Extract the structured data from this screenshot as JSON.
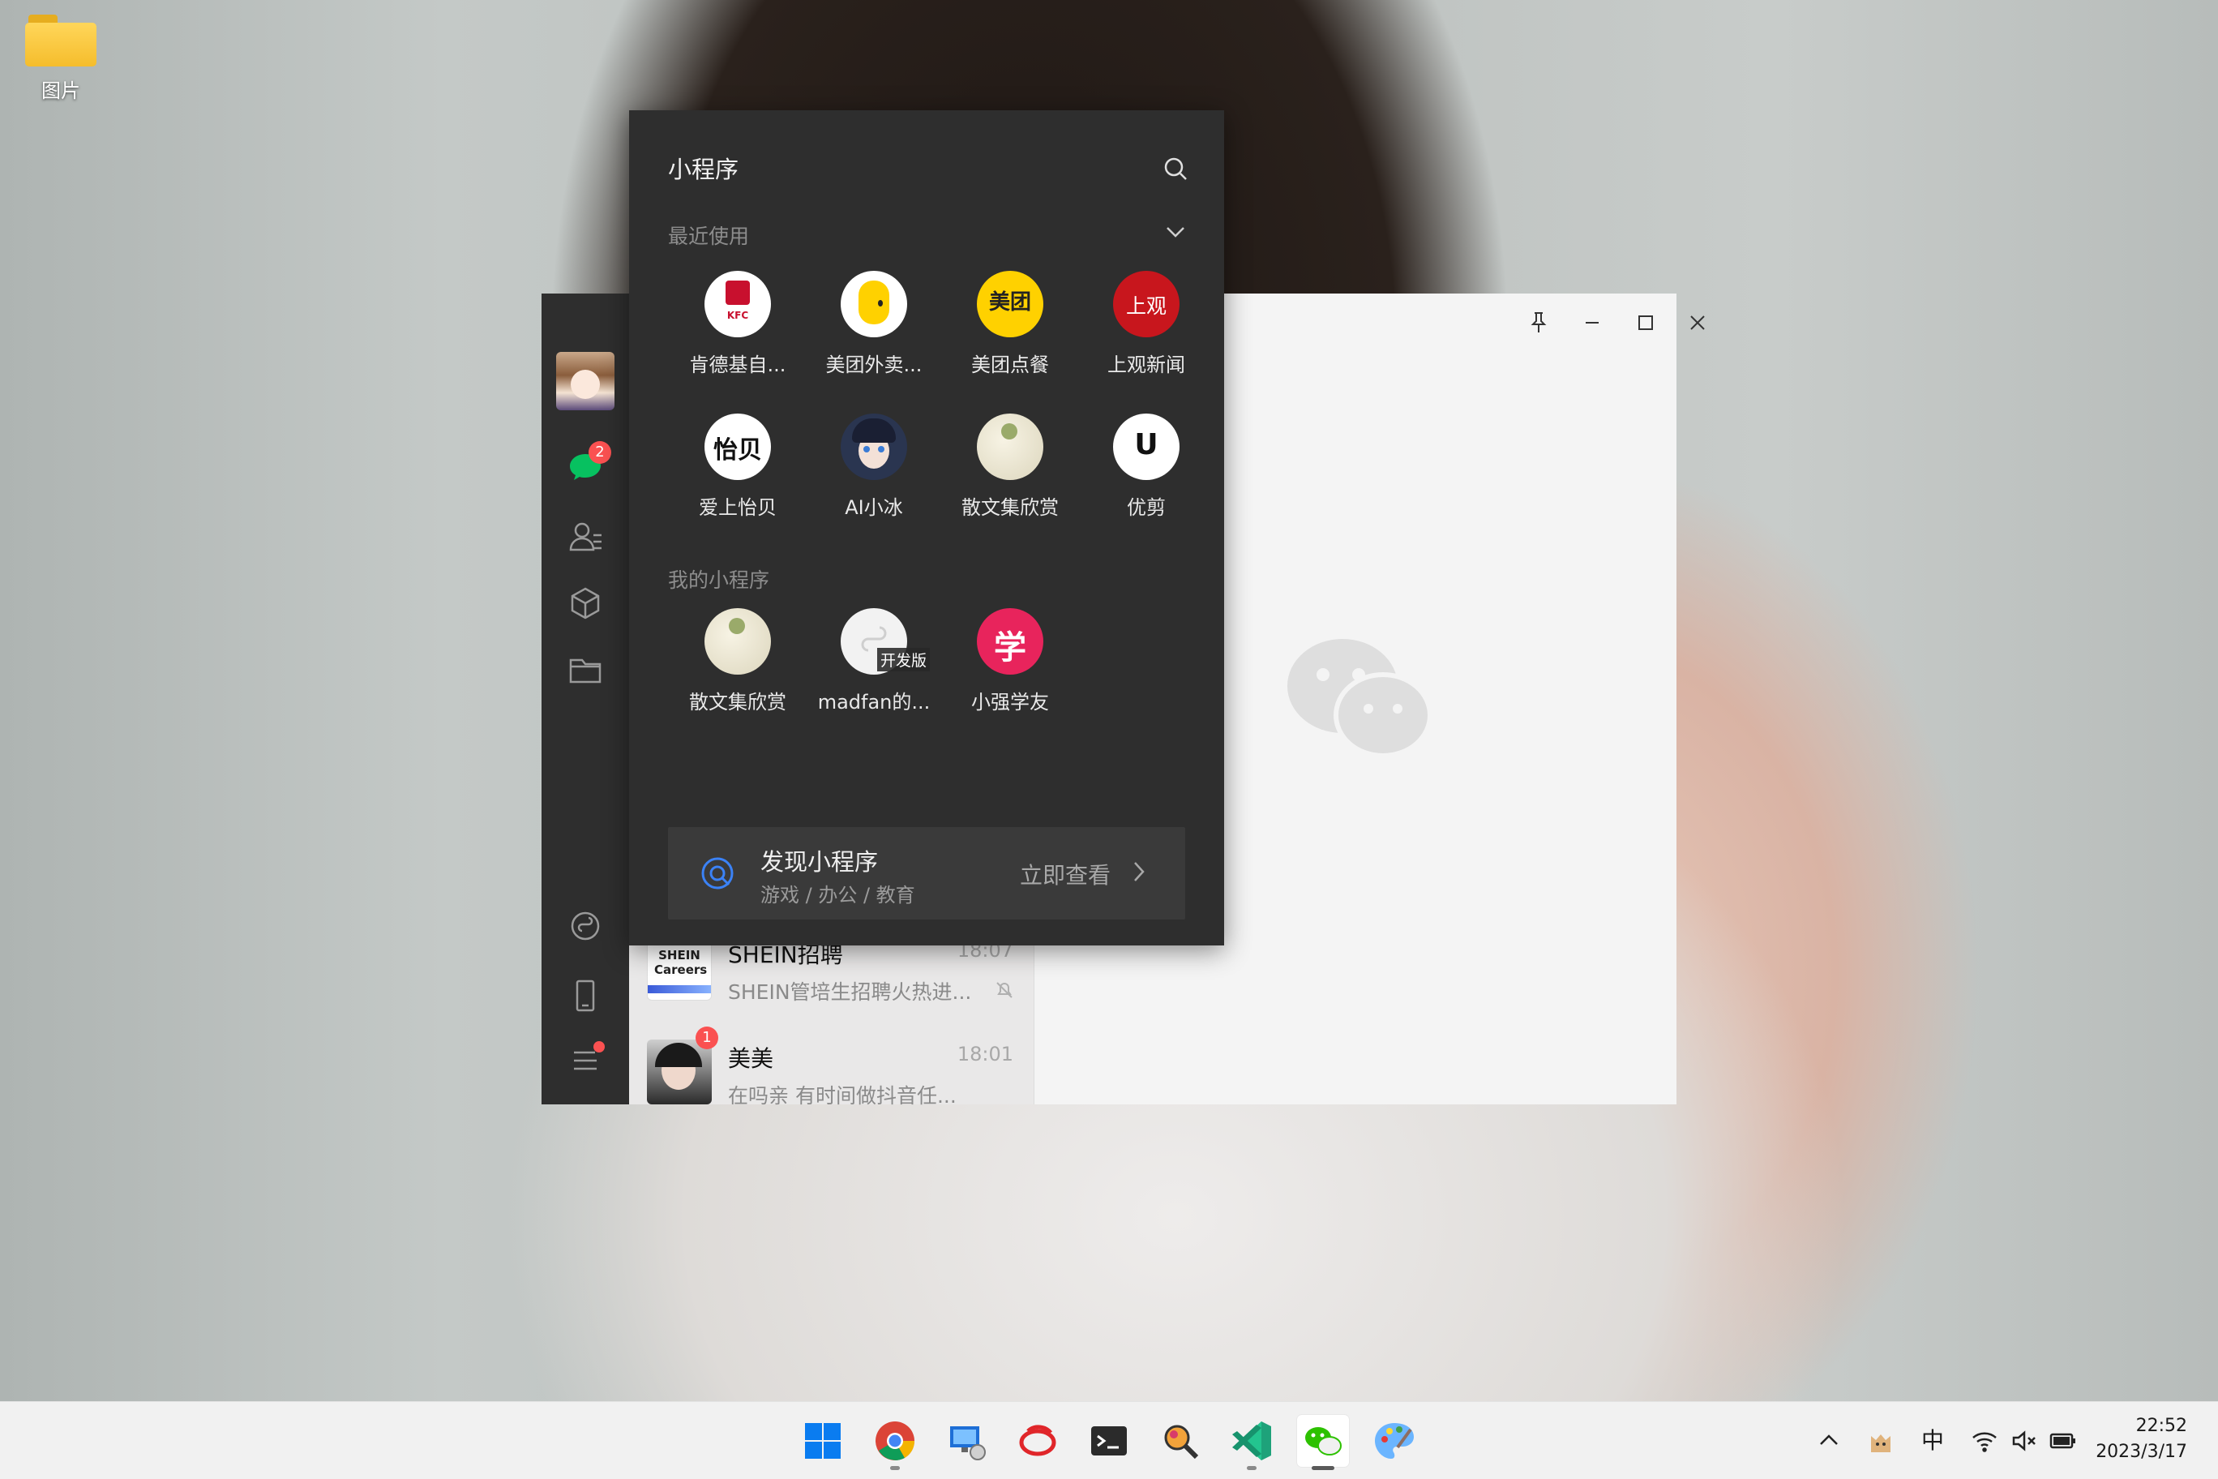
{
  "desktop": {
    "icons": [
      {
        "label": "图片"
      }
    ]
  },
  "wechat": {
    "sidebar": {
      "chats_badge": "2"
    },
    "chat_list": [
      {
        "name": "SHEIN招聘",
        "time": "18:07",
        "preview": "SHEIN管培生招聘火热进...",
        "avatar_text": "SHEIN Careers"
      },
      {
        "name": "美美",
        "time": "18:01",
        "preview": "在吗亲  有时间做抖音任...",
        "unread": "1"
      }
    ]
  },
  "mini_programs": {
    "title": "小程序",
    "recent_label": "最近使用",
    "recent": [
      {
        "name": "肯德基自...",
        "icon_text": "KFC"
      },
      {
        "name": "美团外卖...",
        "icon_text": ""
      },
      {
        "name": "美团点餐",
        "icon_text": "美团"
      },
      {
        "name": "上观新闻",
        "icon_text": "上观"
      },
      {
        "name": "爱上怡贝",
        "icon_text": "怡贝"
      },
      {
        "name": "AI小冰",
        "icon_text": ""
      },
      {
        "name": "散文集欣赏",
        "icon_text": ""
      },
      {
        "name": "优剪",
        "icon_text": "U"
      }
    ],
    "mine_label": "我的小程序",
    "mine": [
      {
        "name": "散文集欣赏",
        "icon_text": ""
      },
      {
        "name": "madfan的...",
        "icon_text": "",
        "tag": "开发版"
      },
      {
        "name": "小强学友",
        "icon_text": "学"
      }
    ],
    "discover": {
      "title": "发现小程序",
      "subtitle": "游戏 / 办公 / 教育",
      "action": "立即查看"
    }
  },
  "taskbar": {
    "apps": [
      "start",
      "chrome",
      "remote-desktop",
      "netease-music",
      "terminal",
      "magnifier-tool",
      "vscode",
      "wechat",
      "paint"
    ],
    "active": "wechat",
    "tray": {
      "ime": "中",
      "time": "22:52",
      "date": "2023/3/17"
    }
  },
  "colors": {
    "wechat_green": "#07c160",
    "badge_red": "#fa5151",
    "panel_bg": "#2e2e2e"
  }
}
